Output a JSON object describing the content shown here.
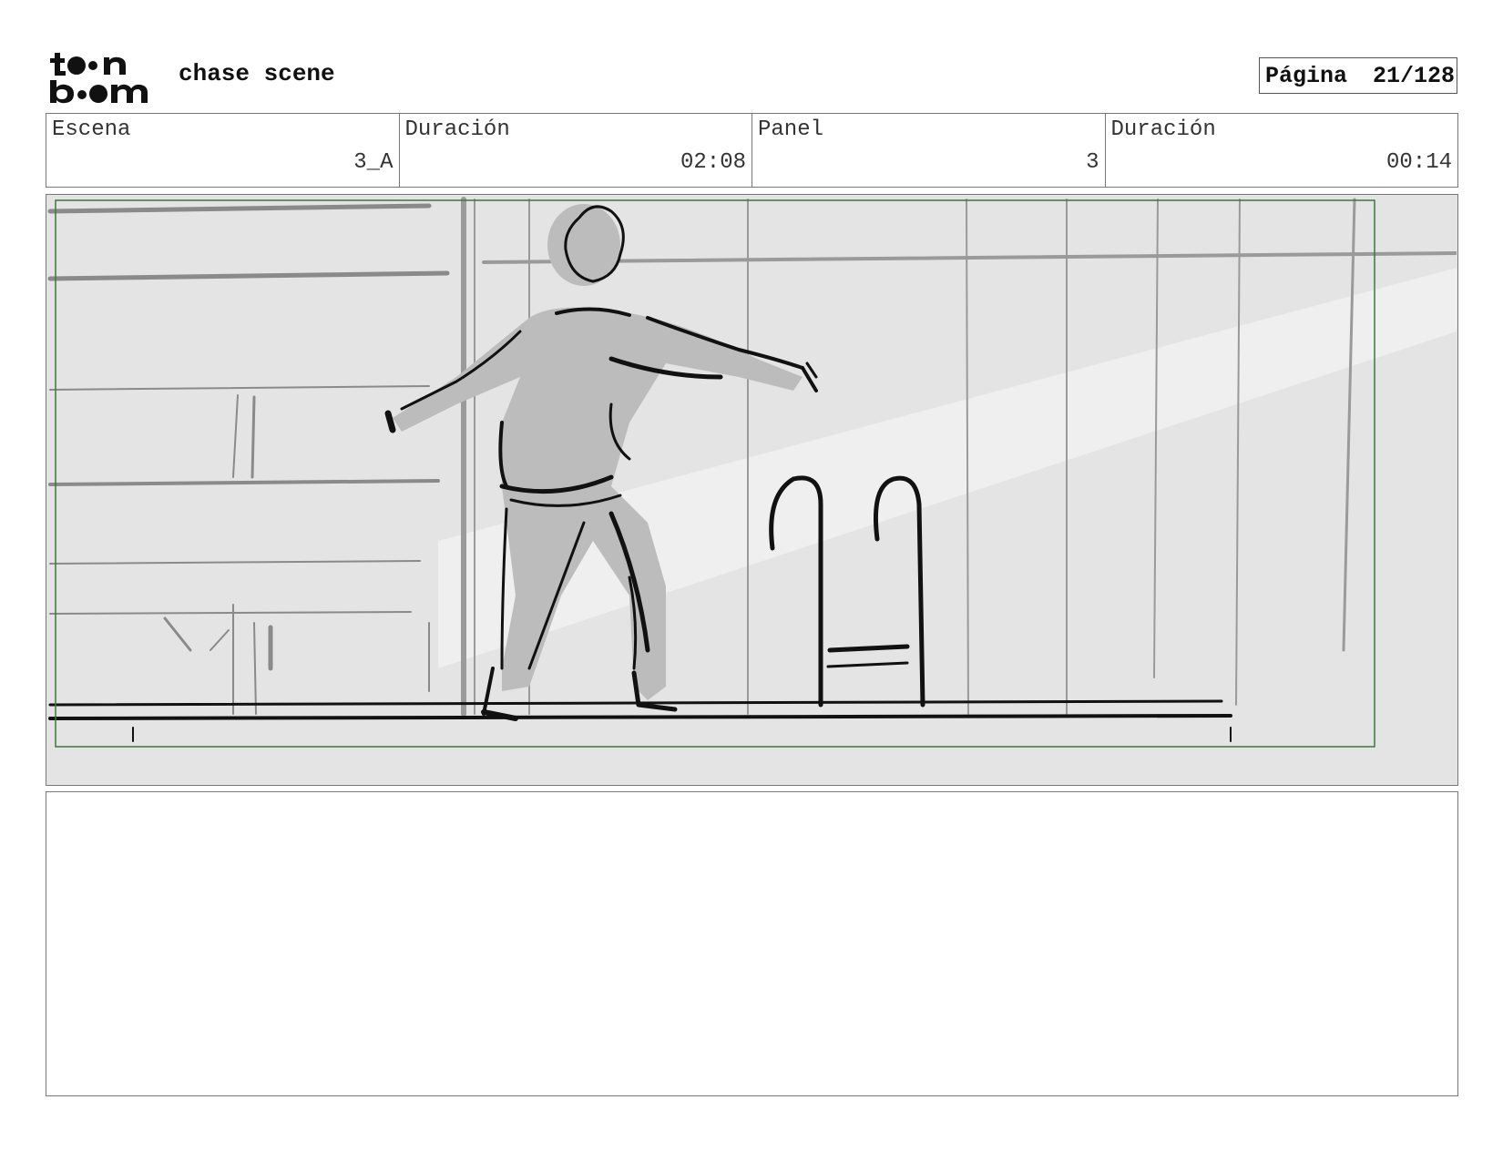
{
  "header": {
    "logo_text_top": "toon",
    "logo_text_bottom": "boom",
    "project_title": "chase scene",
    "page_label": "Página",
    "page_number": "21/128"
  },
  "info": {
    "scene_label": "Escena",
    "scene_value": "3_A",
    "scene_duration_label": "Duración",
    "scene_duration_value": "02:08",
    "panel_label": "Panel",
    "panel_value": "3",
    "panel_duration_label": "Duración",
    "panel_duration_value": "00:14"
  },
  "panel": {
    "image_description": "sketch-of-figure-walking-by-pool-with-ladder",
    "safe_area_color": "#3a7a3a"
  },
  "notes": {
    "text": ""
  }
}
